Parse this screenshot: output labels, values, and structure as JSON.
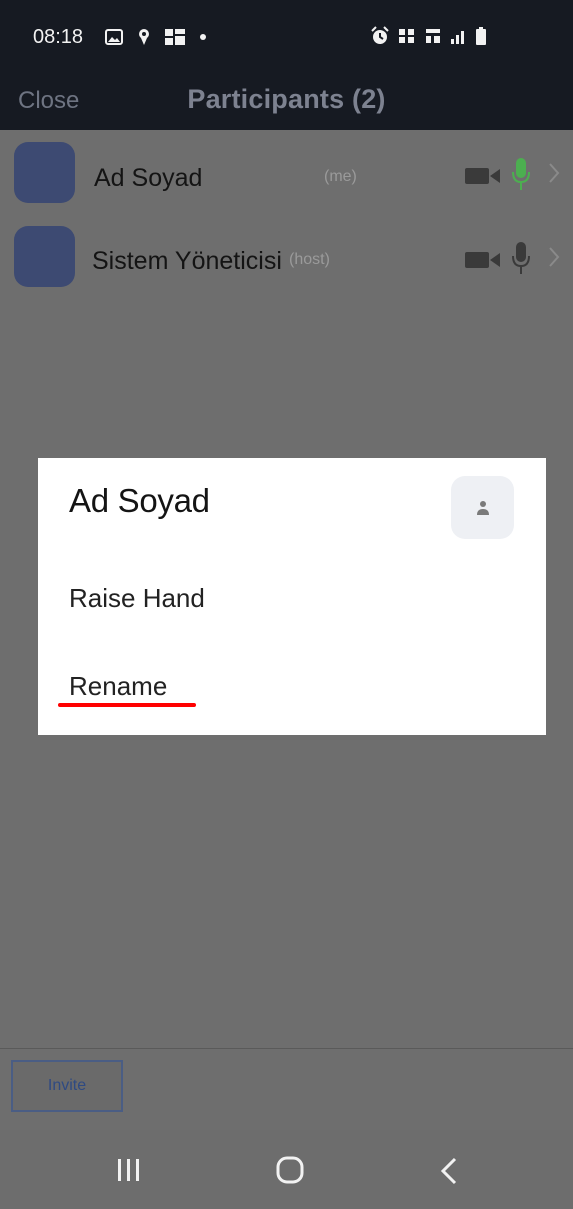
{
  "status_bar": {
    "time": "08:18",
    "left_icons": [
      "gallery-icon",
      "location-icon",
      "app-icon",
      "dot-icon"
    ],
    "right_icons": [
      "alarm-icon",
      "volte-icon",
      "4g-icon",
      "signal-icon",
      "battery-icon"
    ]
  },
  "header": {
    "close_label": "Close",
    "title": "Participants (2)"
  },
  "participants": [
    {
      "name": "Ad Soyad",
      "tag": "(me)",
      "mic_color": "#4caf50"
    },
    {
      "name": "Sistem Yöneticisi",
      "tag": "(host)",
      "mic_color": "#3a3a3a"
    }
  ],
  "popup": {
    "name": "Ad Soyad",
    "items": [
      {
        "label": "Raise Hand"
      },
      {
        "label": "Rename"
      }
    ],
    "highlight_color": "#ff0000"
  },
  "footer": {
    "invite_label": "Invite"
  },
  "nav": {
    "icons": [
      "recent-apps-icon",
      "home-icon",
      "back-icon"
    ]
  }
}
